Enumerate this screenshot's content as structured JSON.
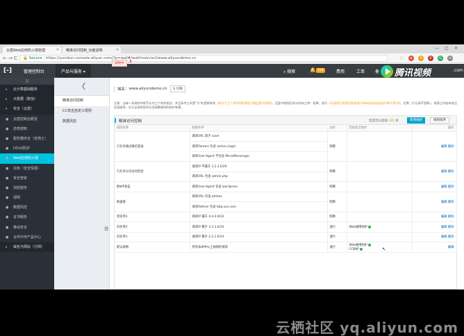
{
  "browser": {
    "tabs": [
      {
        "label": "云盾Web应用防火墙管理",
        "close": "×"
      },
      {
        "label": "精准访问控制_功能说明",
        "close": "×"
      }
    ],
    "win_controls": [
      "—",
      "□",
      "×"
    ],
    "nav": {
      "back": "←",
      "forward": "→",
      "reload": "C"
    },
    "url_secure": "Secure",
    "url": "https://yundun.console.aliyun.com/?p=waf#/waf/main/acl/www.aliyundemo.cn"
  },
  "topnav": {
    "logo": "[-]",
    "home": "管理控制台",
    "products": "产品与服务 ▾",
    "search": "搜索",
    "bell": "🔔",
    "badge": "159",
    "fee": "费用",
    "ticket": "工单",
    "backup": "备",
    "dotcom": ".com"
  },
  "tencent_video": {
    "text": "腾讯视频"
  },
  "sidebar": {
    "collapse": "|||",
    "items": [
      {
        "icon": "▸",
        "label": "云计算基础服务",
        "type": "group"
      },
      {
        "icon": "▸",
        "label": "大数据（数加）",
        "type": "group"
      },
      {
        "icon": "▾",
        "label": "安全（云盾）",
        "type": "group"
      },
      {
        "icon": "●",
        "label": "云盾控制台概览",
        "type": "item"
      },
      {
        "icon": "●",
        "label": "态势感知",
        "type": "item"
      },
      {
        "icon": "●",
        "label": "服务器安全（安骑士）",
        "type": "item"
      },
      {
        "icon": "●",
        "label": "DDoS防护",
        "type": "item"
      },
      {
        "icon": "●",
        "label": "Web应用防火墙",
        "type": "active"
      },
      {
        "icon": "●",
        "label": "先知（安全情报）",
        "type": "item"
      },
      {
        "icon": "●",
        "label": "安全管家",
        "type": "item"
      },
      {
        "icon": "●",
        "label": "加密服务",
        "type": "item"
      },
      {
        "icon": "●",
        "label": "绿网",
        "type": "item"
      },
      {
        "icon": "●",
        "label": "数据风控",
        "type": "item"
      },
      {
        "icon": "●",
        "label": "证书服务",
        "type": "item"
      },
      {
        "icon": "●",
        "label": "移动安全",
        "type": "item"
      },
      {
        "icon": "●",
        "label": "合作伙伴产品中心",
        "type": "item"
      },
      {
        "icon": "▸",
        "label": "域名与网站（万网）",
        "type": "group"
      }
    ]
  },
  "subnav": {
    "back": "〈",
    "items": [
      {
        "label": "精准访问控制",
        "active": true
      },
      {
        "label": "CC攻击自定义规则",
        "active": false
      },
      {
        "label": "数据风控",
        "active": false
      }
    ],
    "splitter": "☰"
  },
  "main": {
    "domain_label": "域名：",
    "domain": "www.aliyundemo.cn",
    "switch": "⇅ 切换",
    "rec_label": "录制中",
    "rec_count": "3",
    "notice_prefix": "注意：当每一条规则中都不允许三个条件组合，并且条件之间是\"与\"的逻辑关系（",
    "notice_hl1": "即以下三个条件同时满足才能匹配中规则",
    "notice_mid": "），匹配中规则后的动作有三种：阻断、放行（",
    "notice_hl2": "可选择后续是否继续进行Web应用攻击防护和CC防护",
    "notice_suffix": "）。告警（只记录不阻断）。规则之间各有先后匹配顺序，任点击规则排序从而调整规则的防护效果。",
    "panel_title": "精准访问控制",
    "quota_prefix": "您还可以添加",
    "quota_n": "181",
    "quota_suffix": "条",
    "btn_new": "新增规则",
    "btn_order": "规则排序",
    "columns": [
      "规则名称",
      "规则条件",
      "动作",
      "后续安全防护",
      "操作"
    ],
    "rows": [
      {
        "name": "只允许通过微信登录",
        "conds": [
          "请求URL 等于 /user",
          "请求Params 包含 action=login",
          "请求User-Agent 不包含 MicroMessenger"
        ],
        "action": "阻断",
        "post": [],
        "op": "编辑 删除"
      },
      {
        "name": "只允许公司访问后台",
        "conds": [
          "请求IP 不属于 1.2.3.0/29",
          "请求URL 包含 admin.php"
        ],
        "action": "阻断",
        "post": [],
        "op": "编辑 删除"
      },
      {
        "name": "防WP攻击",
        "conds": [
          "请求User-Agent 包含 wordpress"
        ],
        "action": "阻断",
        "post": [],
        "op": "编辑 删除"
      },
      {
        "name": "防盗链",
        "conds": [
          "请求URL 包含 photos",
          "请求Referer 包含 bbq.xxx.com"
        ],
        "action": "阻断",
        "post": [],
        "op": "编辑 删除"
      },
      {
        "name": "黑名单1",
        "conds": [
          "请求IP 属于 4.4.4.0/24"
        ],
        "action": "阻断",
        "post": [],
        "op": "编辑 删除"
      },
      {
        "name": "白名单2",
        "conds": [
          "请求IP 属于 3.3.3.0/24"
        ],
        "action": "放行",
        "post": [
          "Web通用防护"
        ],
        "op": "编辑 删除"
      },
      {
        "name": "白名单1",
        "conds": [
          "请求IP 属于 2.2.2.0/24"
        ],
        "action": "放行",
        "post": [],
        "op": "编辑 删除"
      },
      {
        "name": "默认规则",
        "conds": [
          "所有未命中以上规则的请求"
        ],
        "action": "放行",
        "post": [
          "Web通用防护",
          "CC防护"
        ],
        "op": "编辑"
      }
    ]
  },
  "watermark": "云栖社区 yq.aliyun.com",
  "colors": {
    "accent": "#00c1de",
    "topnav": "#373d41",
    "sidebar": "#293038",
    "primary_btn": "#00a2ca",
    "highlight": "#f39800"
  }
}
